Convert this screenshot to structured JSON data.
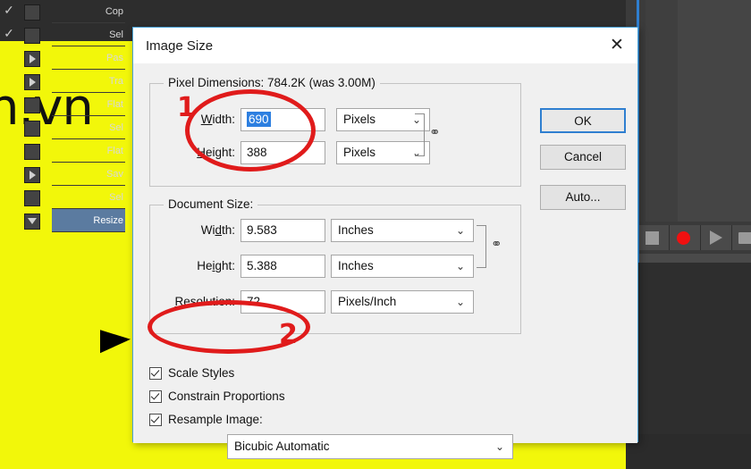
{
  "canvas": {
    "watermark_text": "n.vn",
    "background_color": "#f2f70a"
  },
  "actions_panel": {
    "items": [
      {
        "label": "Cop",
        "has_arrow": false,
        "selected": false
      },
      {
        "label": "Sel",
        "has_arrow": false,
        "selected": false
      },
      {
        "label": "Pas",
        "has_arrow": true,
        "selected": false
      },
      {
        "label": "Tra",
        "has_arrow": true,
        "selected": false
      },
      {
        "label": "Flat",
        "has_arrow": false,
        "selected": false
      },
      {
        "label": "Sel",
        "has_arrow": false,
        "selected": false
      },
      {
        "label": "Flat",
        "has_arrow": false,
        "selected": false
      },
      {
        "label": "Sav",
        "has_arrow": true,
        "selected": false
      },
      {
        "label": "Sel",
        "has_arrow": false,
        "selected": false
      },
      {
        "label": "Resize",
        "has_arrow": false,
        "selected": true
      }
    ],
    "footer_icons": [
      "stop-icon",
      "record-icon",
      "play-icon",
      "folder-icon"
    ],
    "selected_color": "#5b7ba0"
  },
  "dialog": {
    "title": "Image Size",
    "close_glyph": "✕",
    "pixel_dimensions": {
      "legend": "Pixel Dimensions:  784.2K (was 3.00M)",
      "width_label": "Width:",
      "width_label_accel": "W",
      "width_value": "690",
      "width_unit": "Pixels",
      "height_label": "Height:",
      "height_label_accel": "H",
      "height_value": "388",
      "height_unit": "Pixels"
    },
    "document_size": {
      "legend": "Document Size:",
      "width_label": "Width:",
      "width_value": "9.583",
      "width_unit": "Inches",
      "height_label": "Height:",
      "height_value": "5.388",
      "height_unit": "Inches",
      "resolution_label": "Resolution:",
      "resolution_value": "72",
      "resolution_unit": "Pixels/Inch"
    },
    "options": {
      "scale_styles": "Scale Styles",
      "constrain_proportions": "Constrain Proportions",
      "resample_image": "Resample Image:",
      "resample_method": "Bicubic Automatic"
    },
    "buttons": {
      "ok": "OK",
      "cancel": "Cancel",
      "auto": "Auto..."
    },
    "chevron_glyph": "⌄",
    "chain_glyph": "⚭"
  },
  "annotations": {
    "marker_one": "1",
    "marker_two": "2",
    "color": "#e01b1b"
  }
}
